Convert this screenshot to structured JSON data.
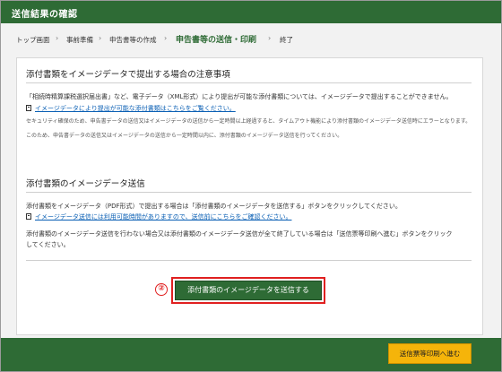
{
  "window": {
    "title": "送信結果の確認"
  },
  "breadcrumb": {
    "items": [
      "トップ画面",
      "事前準備",
      "申告書等の作成",
      "申告書等の送信・印刷",
      "終了"
    ],
    "current_index": 3,
    "separator": "›"
  },
  "section1": {
    "heading": "添付書類をイメージデータで提出する場合の注意事項",
    "line1": "「相続時精算課税選択届出書」など、電子データ（XML形式）により提出が可能な添付書類については、イメージデータで提出することができません。",
    "link": "イメージデータにより提出が可能な添付書類はこちらをご覧ください。",
    "note1": "セキュリティ確保のため、申告書データの送信又はイメージデータの送信から一定時間以上経過すると、タイムアウト機能により添付書類のイメージデータ送信時にエラーとなります。",
    "note2": "このため、申告書データの送信又はイメージデータの送信から一定時間以内に、添付書類のイメージデータ送信を行ってください。"
  },
  "section2": {
    "heading": "添付書類のイメージデータ送信",
    "line1": "添付書類をイメージデータ（PDF形式）で提出する場合は「添付書類のイメージデータを送信する」ボタンをクリックしてください。",
    "link": "イメージデータ送信には利用可能時間がありますので、送信前にこちらをご確認ください。",
    "line2a": "添付書類のイメージデータ送信を行わない場合又は添付書類のイメージデータ送信が全て終了している場合は「送信票等印刷へ進む」ボタンをクリック",
    "line2b": "してください。"
  },
  "annotation": {
    "marker": "②"
  },
  "buttons": {
    "send": "添付書類のイメージデータを送信する",
    "next": "送信票等印刷へ進む"
  },
  "colors": {
    "green": "#2e6b35",
    "accent_red": "#e02020",
    "next_yellow": "#f5b40a",
    "link_blue": "#0a5fb4"
  }
}
